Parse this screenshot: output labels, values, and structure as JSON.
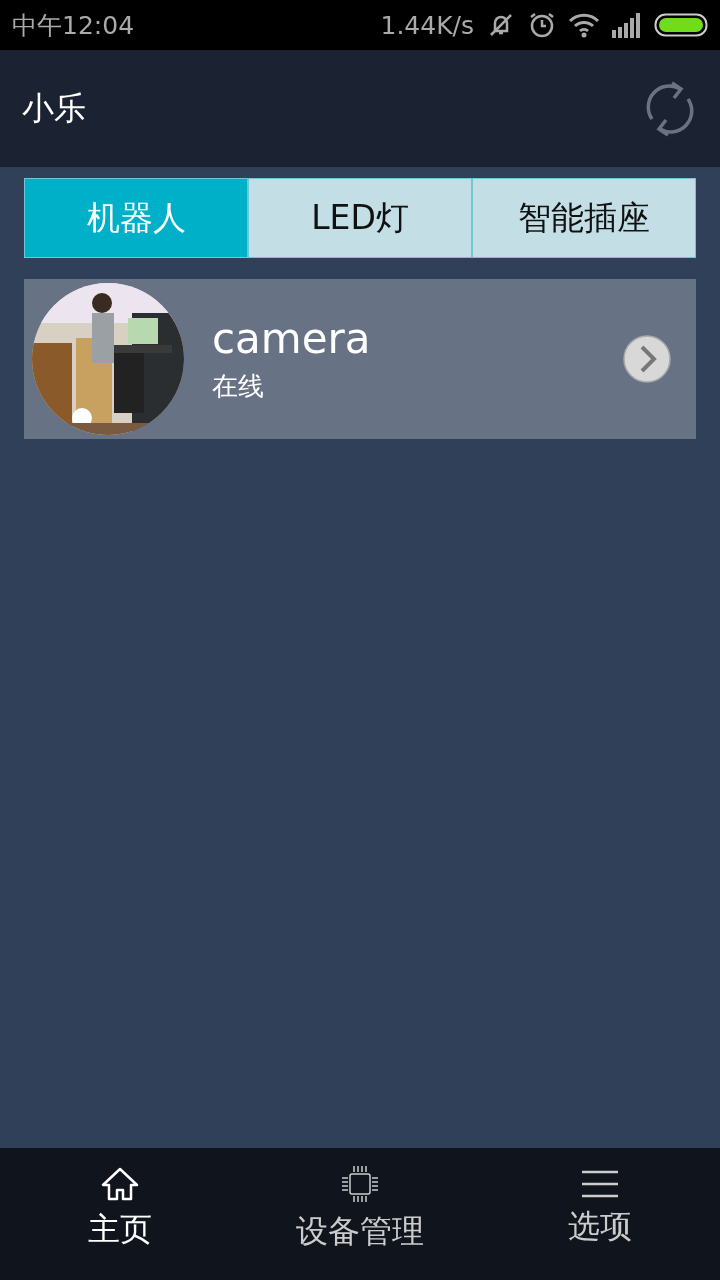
{
  "status_bar": {
    "time": "中午12:04",
    "speed": "1.44K/s"
  },
  "header": {
    "title": "小乐"
  },
  "tabs": [
    {
      "label": "机器人",
      "selected": true
    },
    {
      "label": "LED灯",
      "selected": false
    },
    {
      "label": "智能插座",
      "selected": false
    }
  ],
  "devices": [
    {
      "name": "camera",
      "status": "在线"
    }
  ],
  "nav": [
    {
      "label": "主页",
      "kind": "home",
      "selected": true
    },
    {
      "label": "设备管理",
      "kind": "devices",
      "selected": false
    },
    {
      "label": "选项",
      "kind": "options",
      "selected": false
    }
  ]
}
